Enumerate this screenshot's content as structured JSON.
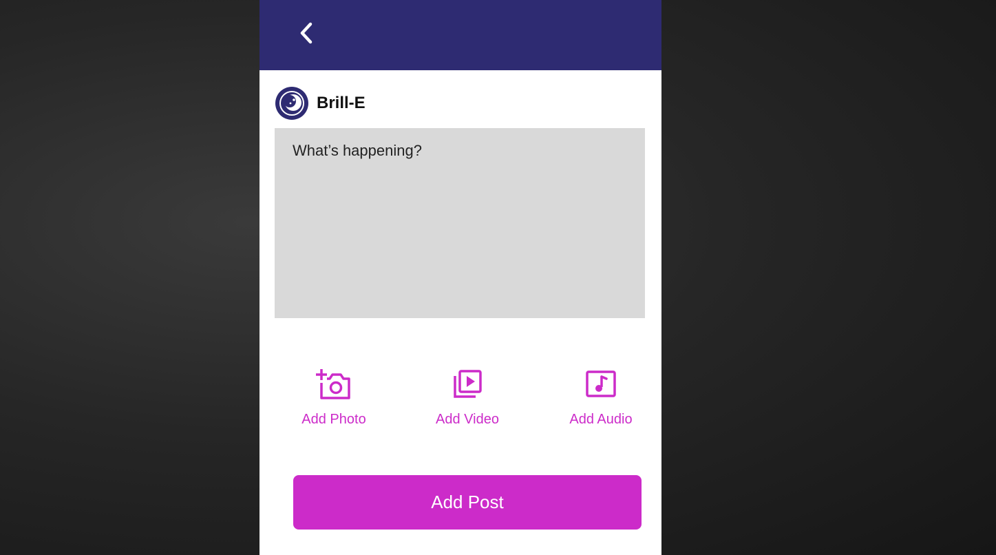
{
  "colors": {
    "header": "#2e2b72",
    "accent": "#cc2bc9",
    "input_bg": "#d9d9d9"
  },
  "header": {
    "back_icon": "chevron-left-icon"
  },
  "user": {
    "name": "Brill-E",
    "avatar_icon": "moon-face-icon"
  },
  "composer": {
    "placeholder": "What’s happening?",
    "value": ""
  },
  "media": {
    "photo": {
      "label": "Add Photo",
      "icon": "add-photo-icon"
    },
    "video": {
      "label": "Add Video",
      "icon": "video-library-icon"
    },
    "audio": {
      "label": "Add Audio",
      "icon": "music-note-icon"
    }
  },
  "actions": {
    "submit_label": "Add Post"
  }
}
